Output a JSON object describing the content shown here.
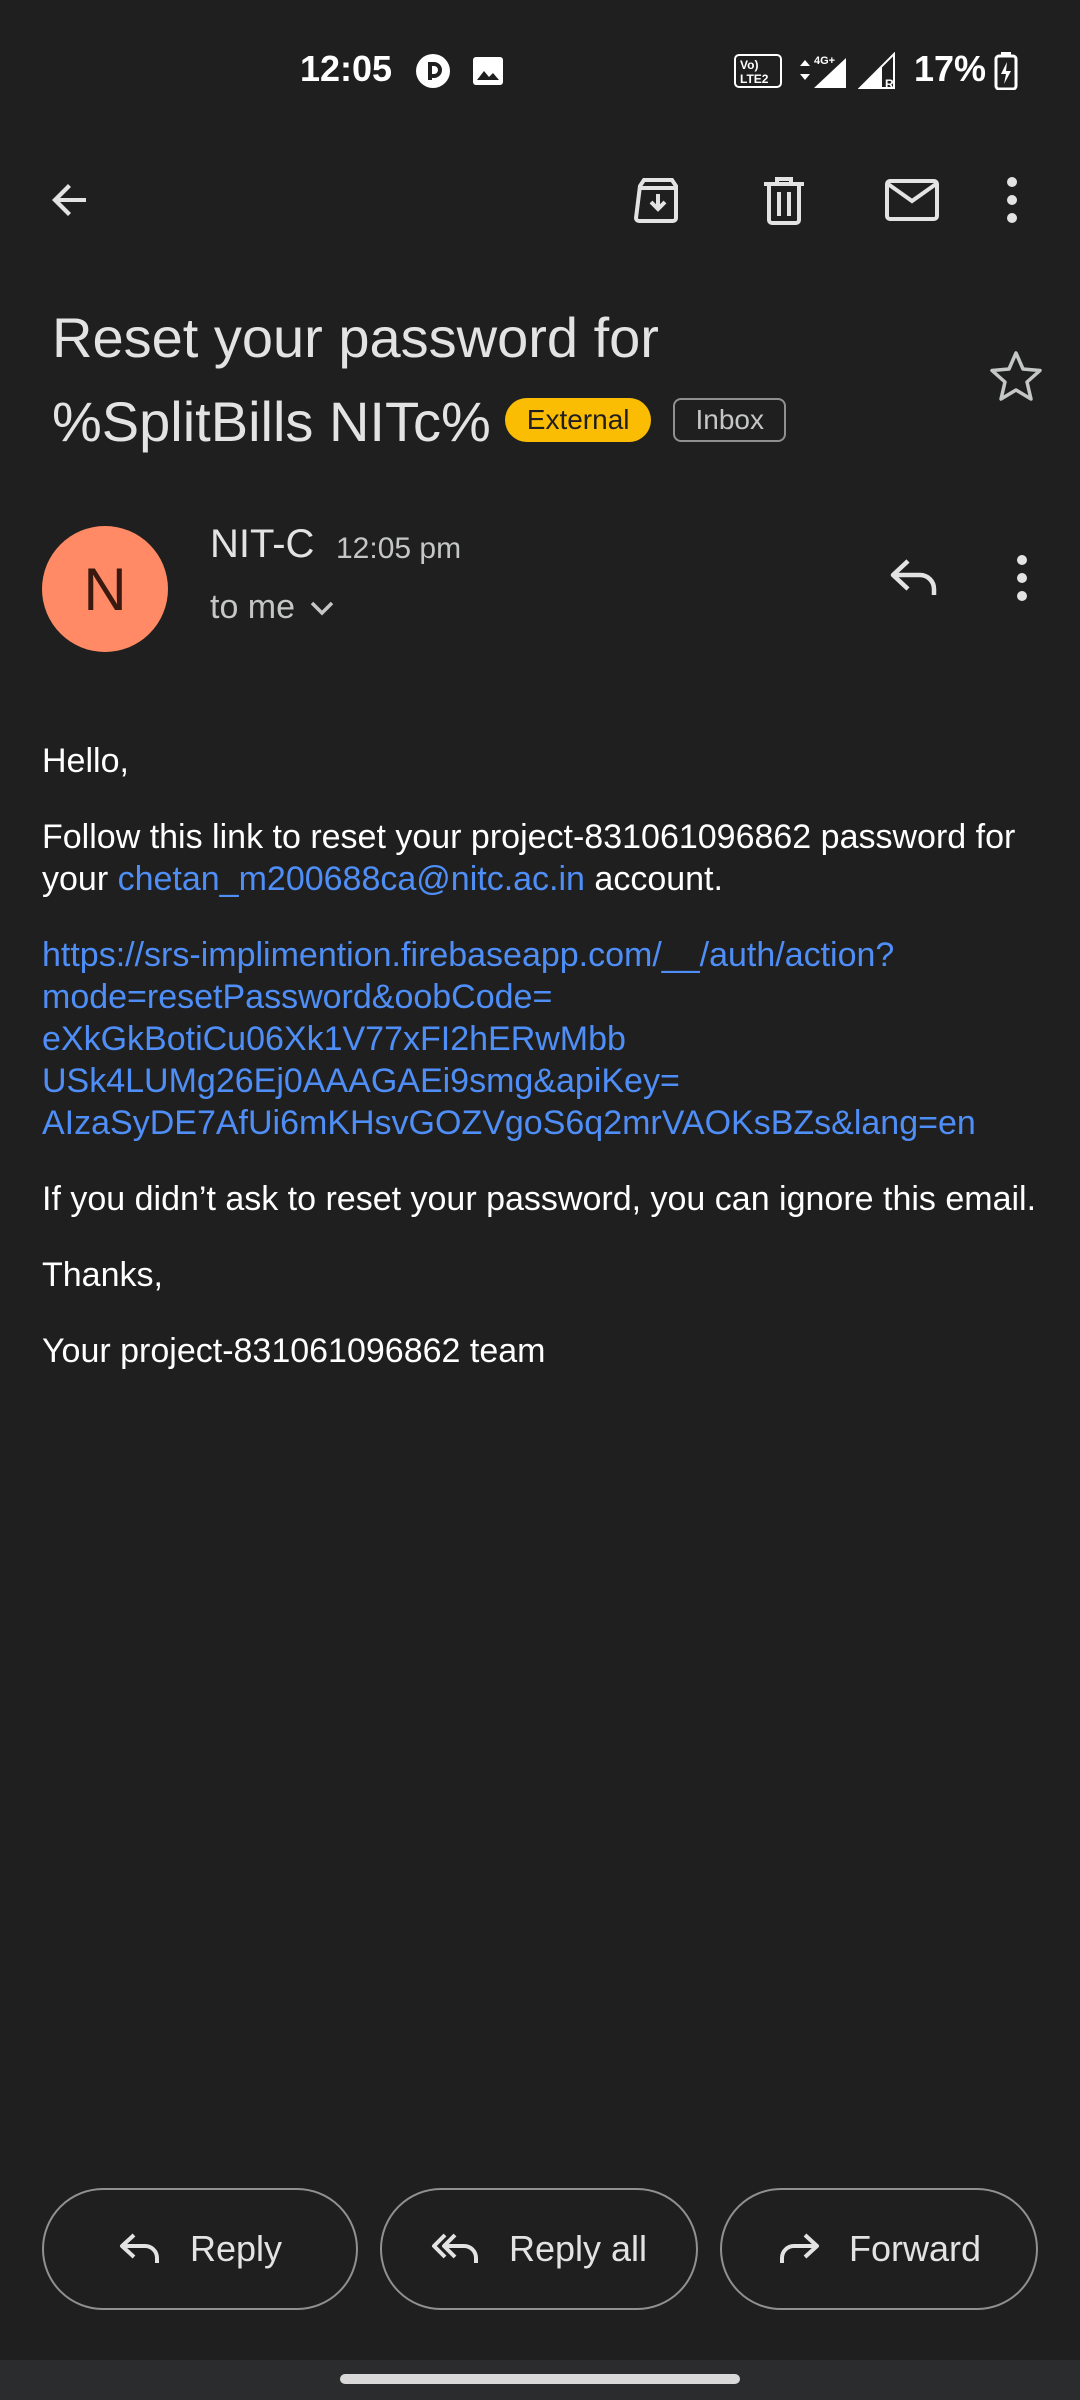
{
  "status_bar": {
    "time": "12:05",
    "battery": "17%",
    "icons": [
      "circle-app-icon",
      "image-icon",
      "volte-icon",
      "data-arrows-icon",
      "signal-icon",
      "battery-icon"
    ]
  },
  "toolbar": {
    "icons": [
      "back-arrow-icon",
      "archive-icon",
      "delete-icon",
      "mark-unread-icon",
      "more-vert-icon"
    ]
  },
  "subject": {
    "line1": "Reset your password for",
    "line2": "%SplitBills NITc%",
    "label_external": "External",
    "label_inbox": "Inbox"
  },
  "sender": {
    "initial": "N",
    "name": "NIT-C",
    "time": "12:05 pm",
    "recipient": "to me",
    "avatar_color": "#ff8a65"
  },
  "body": {
    "greeting": "Hello,",
    "para1_prefix": "Follow this link to reset your project-831061096862 password for your ",
    "email_link": "chetan_m200688ca@nitc.ac.in",
    "para1_suffix": " account.",
    "reset_link_lines": [
      "https://srs-implimention.firebaseapp.com/__/auth/action?",
      "mode=resetPassword&oobCode=",
      "eXkGkBotiCu06Xk1V77xFI2hERwMbb",
      "USk4LUMg26Ej0AAAGAEi9smg&apiKey=",
      "AIzaSyDE7AfUi6mKHsvGOZVgoS6q2mrVAOKsBZs&lang=en"
    ],
    "para3": "If you didn’t ask to reset your password, you can ignore this email.",
    "thanks": "Thanks,",
    "signature": "Your project-831061096862 team"
  },
  "actions": {
    "reply": "Reply",
    "reply_all": "Reply all",
    "forward": "Forward"
  },
  "colors": {
    "background": "#1f1f1f",
    "link": "#4f8ef7",
    "external_chip": "#fbbc04"
  }
}
